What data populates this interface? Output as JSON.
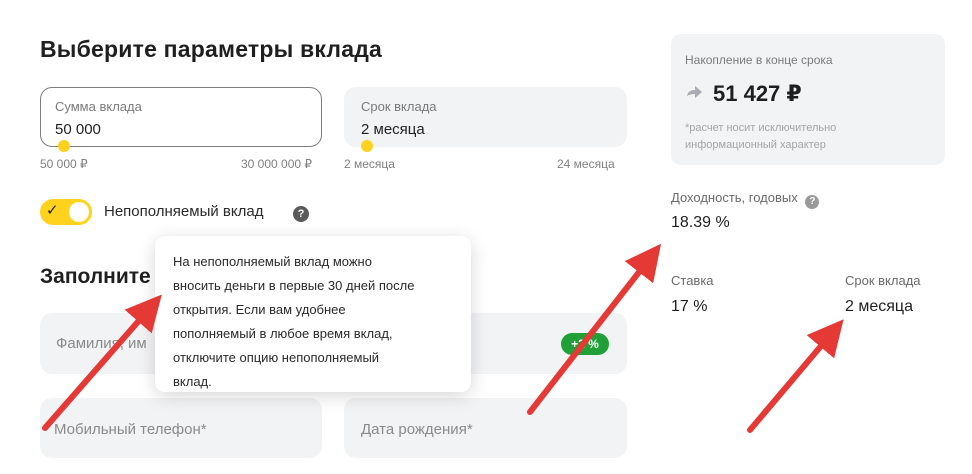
{
  "page": {
    "title": "Выберите параметры вклада",
    "section_title": "Заполните"
  },
  "amount_field": {
    "label": "Сумма вклада",
    "value": "50 000",
    "range_min": "50 000 ₽",
    "range_max": "30 000 000 ₽",
    "slider_fraction": 0
  },
  "term_field": {
    "label": "Срок вклада",
    "value": "2 месяца",
    "range_min": "2 месяца",
    "range_max": "24 месяца",
    "slider_fraction": 0
  },
  "toggle": {
    "label": "Непополняемый вклад",
    "on": true
  },
  "tooltip": {
    "lines": [
      "На непополняемый вклад можно",
      "вносить деньги в первые 30 дней после",
      "открытия. Если вам удобнее",
      "пополняемый в любое время вклад,",
      "отключите опцию непополняемый",
      "вклад."
    ]
  },
  "form": {
    "fio_placeholder": "Фамилия, им",
    "badge": "+2 %",
    "phone_placeholder": "Мобильный телефон*",
    "birthdate_placeholder": "Дата рождения*"
  },
  "summary": {
    "accumulation_label": "Накопление в конце срока",
    "accumulation_value": "51 427 ₽",
    "note": "*расчет носит исключительно информационный характер",
    "yield_label": "Доходность, годовых",
    "yield_value": "18.39 %",
    "rate_label": "Ставка",
    "rate_value": "17 %",
    "term_label": "Срок вклада",
    "term_value": "2 месяца"
  },
  "colors": {
    "accent_yellow": "#ffd21e",
    "badge_green": "#21a038",
    "arrow_red": "#e53935",
    "field_bg": "#f2f3f5"
  },
  "icons": {
    "help": "question-circle-icon",
    "check": "check-icon",
    "accumulation": "refresh-arrow-icon"
  }
}
